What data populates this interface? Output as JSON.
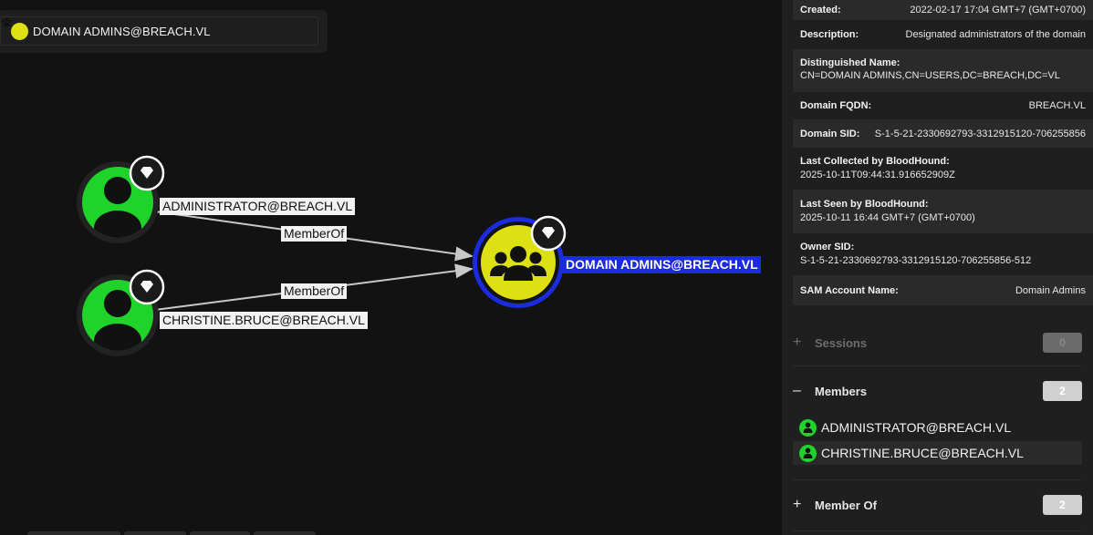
{
  "search": {
    "value": "DOMAIN ADMINS@BREACH.VL",
    "icon": "group-icon"
  },
  "graph": {
    "nodes": [
      {
        "label": "ADMINISTRATOR@BREACH.VL",
        "type": "user",
        "color": "#1fd32a",
        "badge": "tier-zero-icon"
      },
      {
        "label": "CHRISTINE.BRUCE@BREACH.VL",
        "type": "user",
        "color": "#1fd32a",
        "badge": "tier-zero-icon"
      },
      {
        "label": "DOMAIN ADMINS@BREACH.VL",
        "type": "group",
        "color": "#dde114",
        "badge": "tier-zero-icon",
        "selected": true
      }
    ],
    "edges": [
      {
        "label": "MemberOf"
      },
      {
        "label": "MemberOf"
      }
    ],
    "selection_color": "#1b2bde"
  },
  "properties": {
    "created": {
      "k": "Created:",
      "v": "2022-02-17 17:04 GMT+7 (GMT+0700)"
    },
    "description": {
      "k": "Description:",
      "v": "Designated administrators of the domain"
    },
    "dn": {
      "k": "Distinguished Name:",
      "v": "CN=DOMAIN ADMINS,CN=USERS,DC=BREACH,DC=VL"
    },
    "fqdn": {
      "k": "Domain FQDN:",
      "v": "BREACH.VL"
    },
    "sid": {
      "k": "Domain SID:",
      "v": "S-1-5-21-2330692793-3312915120-706255856"
    },
    "last_collected": {
      "k": "Last Collected by BloodHound:",
      "v": "2025-10-11T09:44:31.916652909Z"
    },
    "last_seen": {
      "k": "Last Seen by BloodHound:",
      "v": "2025-10-11 16:44 GMT+7 (GMT+0700)"
    },
    "owner_sid": {
      "k": "Owner SID:",
      "v": "S-1-5-21-2330692793-3312915120-706255856-512"
    },
    "sam": {
      "k": "SAM Account Name:",
      "v": "Domain Admins"
    }
  },
  "sections": {
    "sessions": {
      "sign": "+",
      "title": "Sessions",
      "count": "0"
    },
    "members": {
      "sign": "–",
      "title": "Members",
      "count": "2",
      "items": [
        "ADMINISTRATOR@BREACH.VL",
        "CHRISTINE.BRUCE@BREACH.VL"
      ]
    },
    "member_of": {
      "sign": "+",
      "title": "Member Of",
      "count": "2"
    }
  }
}
